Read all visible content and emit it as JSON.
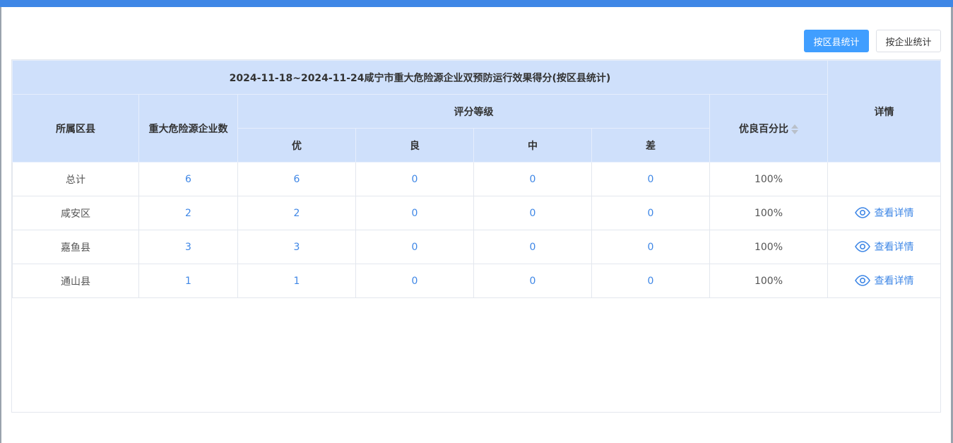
{
  "toolbar": {
    "by_county_label": "按区县统计",
    "by_enterprise_label": "按企业统计"
  },
  "table": {
    "title": "2024-11-18~2024-11-24咸宁市重大危险源企业双预防运行效果得分(按区县统计)",
    "headers": {
      "district": "所属区县",
      "count": "重大危险源企业数",
      "rating_group": "评分等级",
      "excellent": "优",
      "good": "良",
      "medium": "中",
      "poor": "差",
      "ratio": "优良百分比",
      "detail": "详情"
    },
    "rows": [
      {
        "district": "总计",
        "count": "6",
        "excellent": "6",
        "good": "0",
        "medium": "0",
        "poor": "0",
        "ratio": "100%",
        "detail": ""
      },
      {
        "district": "咸安区",
        "count": "2",
        "excellent": "2",
        "good": "0",
        "medium": "0",
        "poor": "0",
        "ratio": "100%",
        "detail": "查看详情"
      },
      {
        "district": "嘉鱼县",
        "count": "3",
        "excellent": "3",
        "good": "0",
        "medium": "0",
        "poor": "0",
        "ratio": "100%",
        "detail": "查看详情"
      },
      {
        "district": "通山县",
        "count": "1",
        "excellent": "1",
        "good": "0",
        "medium": "0",
        "poor": "0",
        "ratio": "100%",
        "detail": "查看详情"
      }
    ]
  },
  "colors": {
    "accent": "#409eff",
    "header_bg": "#cfe0fb",
    "link": "#3f87e6",
    "top_bar": "#3f87e6"
  }
}
